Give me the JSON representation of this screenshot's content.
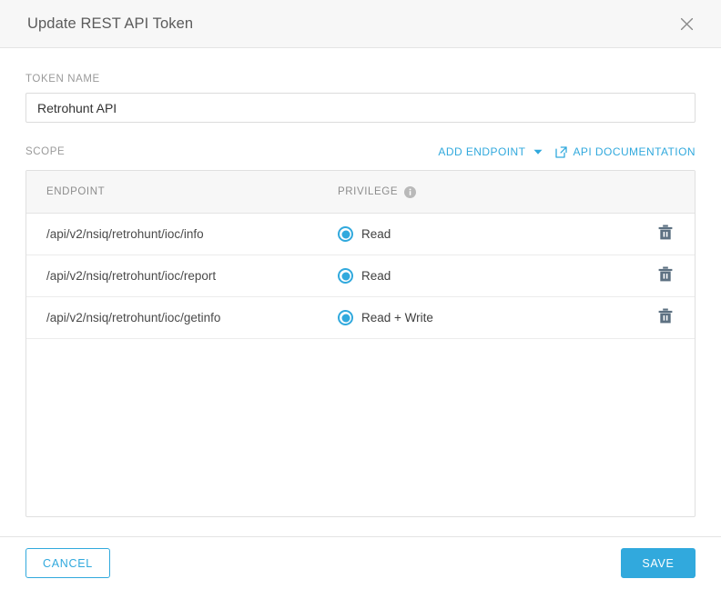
{
  "dialog": {
    "title": "Update REST API Token",
    "close_icon": "close-icon"
  },
  "token_name": {
    "label": "TOKEN NAME",
    "value": "Retrohunt API",
    "placeholder": "Token name"
  },
  "scope": {
    "label": "SCOPE",
    "add_endpoint_label": "ADD ENDPOINT",
    "caret_icon": "chevron-down-icon",
    "api_doc_label": "API DOCUMENTATION",
    "external_link_icon": "external-link-icon",
    "columns": {
      "endpoint": "ENDPOINT",
      "privilege": "PRIVILEGE",
      "privilege_info_icon": "info-icon"
    },
    "rows": [
      {
        "endpoint": "/api/v2/nsiq/retrohunt/ioc/info",
        "privilege": "Read",
        "delete_icon": "trash-icon"
      },
      {
        "endpoint": "/api/v2/nsiq/retrohunt/ioc/report",
        "privilege": "Read",
        "delete_icon": "trash-icon"
      },
      {
        "endpoint": "/api/v2/nsiq/retrohunt/ioc/getinfo",
        "privilege": "Read + Write",
        "delete_icon": "trash-icon"
      }
    ]
  },
  "footer": {
    "cancel_label": "CANCEL",
    "save_label": "SAVE"
  },
  "colors": {
    "accent": "#31a9dd",
    "header_bg": "#f7f7f7",
    "border": "#e0e0e0",
    "trash": "#5d7182",
    "muted_text": "#9a9a9a"
  }
}
